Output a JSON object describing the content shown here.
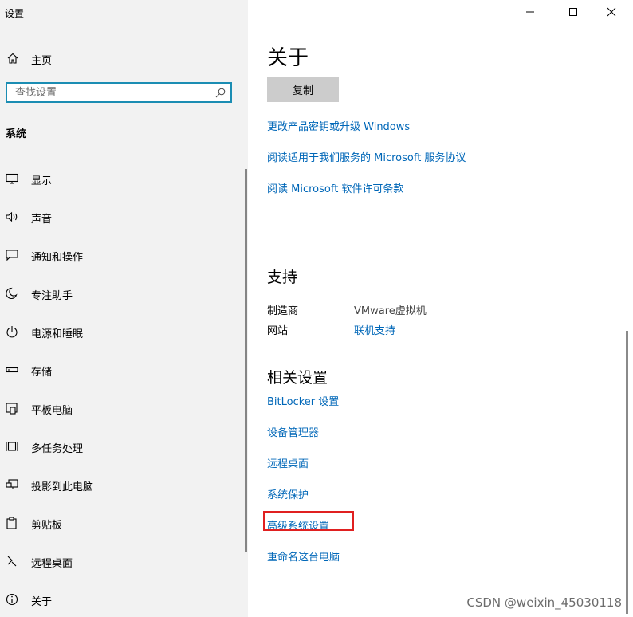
{
  "sidebar": {
    "app_title": "设置",
    "home_label": "主页",
    "search_placeholder": "查找设置",
    "section_title": "系统",
    "items": [
      {
        "label": "显示"
      },
      {
        "label": "声音"
      },
      {
        "label": "通知和操作"
      },
      {
        "label": "专注助手"
      },
      {
        "label": "电源和睡眠"
      },
      {
        "label": "存储"
      },
      {
        "label": "平板电脑"
      },
      {
        "label": "多任务处理"
      },
      {
        "label": "投影到此电脑"
      },
      {
        "label": "剪贴板"
      },
      {
        "label": "远程桌面"
      },
      {
        "label": "关于"
      }
    ]
  },
  "main": {
    "title": "关于",
    "copy_button": "复制",
    "links": [
      "更改产品密钥或升级 Windows",
      "阅读适用于我们服务的 Microsoft 服务协议",
      "阅读 Microsoft 软件许可条款"
    ],
    "support": {
      "heading": "支持",
      "manufacturer_label": "制造商",
      "manufacturer_value": "VMware虚拟机",
      "website_label": "网站",
      "website_link": "联机支持"
    },
    "related": {
      "heading": "相关设置",
      "links": [
        "BitLocker 设置",
        "设备管理器",
        "远程桌面",
        "系统保护",
        "高级系统设置",
        "重命名这台电脑"
      ]
    }
  },
  "colors": {
    "link": "#0067b8",
    "sidebar_bg": "#f2f2f2",
    "search_border": "#1b8db3",
    "highlight_border": "#e02020"
  },
  "watermark": "CSDN @weixin_45030118"
}
